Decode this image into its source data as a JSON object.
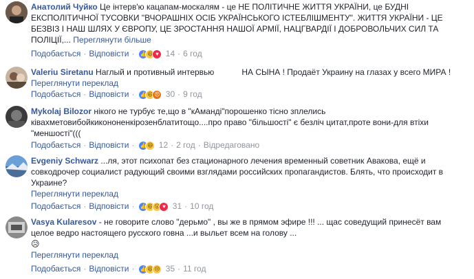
{
  "labels": {
    "like": "Подобається",
    "reply": "Відповісти",
    "translate": "Переглянути переклад",
    "see_more": "Переглянути більше",
    "edited": "Відредаговано"
  },
  "comments": [
    {
      "author": "Анатолий Чуйко",
      "text": " Це інтерв'ю кацапам-москалям - це НЕ ПОЛІТИЧНЕ ЖИТТЯ УКРАЇНИ, це БУДНІ ЕКСПОЛІТИЧНОЇ ТУСОВКИ \"ВЧОРАШНІХ ОСІБ УКРАЇНСЬКОГО ІСТЕБЛІШМЕНТУ\". ЖИТТЯ УКРАЇНИ - ЦЕ БЕЗВІЗ І НАШ ШЛЯХ У ЄВРОПУ, ЦЕ ЗРОСТАННЯ НАШОЇ АРМІЇ, НАЦГВАРДІЇ І ДОБРОВОЛЬЧИХ СИЛ ТА ПОЛІЦІЇ,...",
      "count": "14",
      "time": "6 год"
    },
    {
      "author": "Valeriu Siretanu",
      "text_a": " Наглый и противный интервью",
      "text_b": "НА СЫНА ! Продаёт Украину на глазах у всего МИРА !",
      "count": "30",
      "time": "9 год"
    },
    {
      "author": "Mykolaj Bilozor",
      "text": " нікого не турбує те,що в \"кАманді\"порошенко тісно зплелись ківаxметовибойкикононенкірозенблатитощо....про право \"більшості\" є безліч цитат,проте вони-для втіхи \"меншості\"(((",
      "count": "12",
      "time": "2 год"
    },
    {
      "author": "Evgeniy Schwarz",
      "text": " ...ля, этот психопат без стационарного лечения временный советник Авакова, ещё и совкодрочер социалист радующий своими взглядами российских пропагандистов. Блять, что происходит в Украине?",
      "count": "31",
      "time": "10 год"
    },
    {
      "author": "Vasya Kularesov",
      "text": " - не говорите слово \"дерьмо\" , вы же в прямом эфире !!! ... щас соведущий принесёт вам целое ведро настоящего русского говна ...и выльет всем на голову ...",
      "emoji": "😥",
      "count": "35",
      "time": "11 год"
    }
  ]
}
